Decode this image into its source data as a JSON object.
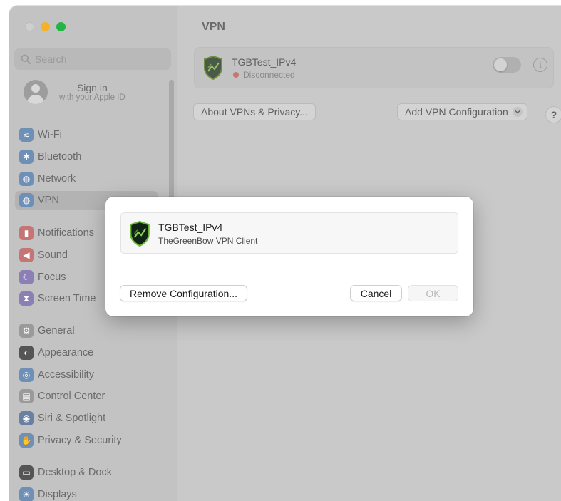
{
  "sidebar": {
    "search_placeholder": "Search",
    "account": {
      "title": "Sign in",
      "subtitle": "with your Apple ID"
    },
    "groups": [
      [
        {
          "label": "Wi-Fi",
          "icon": "wifi-icon",
          "color": "#6e8fb6",
          "glyph": "≋"
        },
        {
          "label": "Bluetooth",
          "icon": "bluetooth-icon",
          "color": "#6e8fb6",
          "glyph": "✱"
        },
        {
          "label": "Network",
          "icon": "globe-icon",
          "color": "#6e8fb6",
          "glyph": "◍"
        },
        {
          "label": "VPN",
          "icon": "vpn-globe-icon",
          "color": "#6e8fb6",
          "glyph": "◍",
          "selected": true
        }
      ],
      [
        {
          "label": "Notifications",
          "icon": "bell-icon",
          "color": "#c57674",
          "glyph": "▮"
        },
        {
          "label": "Sound",
          "icon": "speaker-icon",
          "color": "#c57674",
          "glyph": "◀"
        },
        {
          "label": "Focus",
          "icon": "moon-icon",
          "color": "#8c7fb5",
          "glyph": "☾"
        },
        {
          "label": "Screen Time",
          "icon": "hourglass-icon",
          "color": "#8c7fb5",
          "glyph": "⧗"
        }
      ],
      [
        {
          "label": "General",
          "icon": "gear-icon",
          "color": "#9a9a9a",
          "glyph": "⚙"
        },
        {
          "label": "Appearance",
          "icon": "appearance-icon",
          "color": "#555555",
          "glyph": "◐"
        },
        {
          "label": "Accessibility",
          "icon": "accessibility-icon",
          "color": "#6e8fb6",
          "glyph": "◎"
        },
        {
          "label": "Control Center",
          "icon": "control-center-icon",
          "color": "#9a9a9a",
          "glyph": "▤"
        },
        {
          "label": "Siri & Spotlight",
          "icon": "siri-icon",
          "color": "#6b7fa0",
          "glyph": "◉"
        },
        {
          "label": "Privacy & Security",
          "icon": "hand-icon",
          "color": "#6e8fb6",
          "glyph": "✋"
        }
      ],
      [
        {
          "label": "Desktop & Dock",
          "icon": "dock-icon",
          "color": "#555555",
          "glyph": "▭"
        },
        {
          "label": "Displays",
          "icon": "displays-icon",
          "color": "#6e8fb6",
          "glyph": "☀"
        }
      ]
    ]
  },
  "main": {
    "title": "VPN",
    "vpn": {
      "name": "TGBTest_IPv4",
      "status": "Disconnected",
      "status_color": "#c77671"
    },
    "about_button": "About VPNs & Privacy...",
    "add_button": "Add VPN Configuration",
    "help_button": "?"
  },
  "dialog": {
    "item_name": "TGBTest_IPv4",
    "item_sub": "TheGreenBow VPN Client",
    "remove_button": "Remove Configuration...",
    "cancel_button": "Cancel",
    "ok_button": "OK"
  }
}
